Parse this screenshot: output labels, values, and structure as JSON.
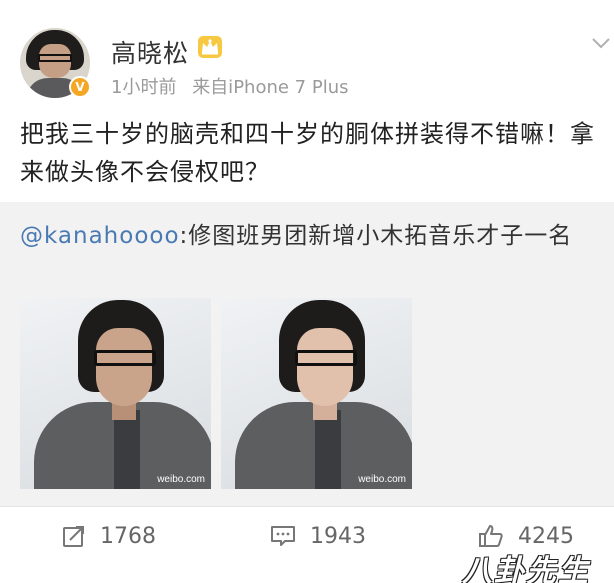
{
  "post": {
    "author": "高晓松",
    "time": "1小时前",
    "source": "来自iPhone 7 Plus",
    "verified_mark": "V",
    "text": "把我三十岁的脑壳和四十岁的胴体拼装得不错嘛！拿来做头像不会侵权吧？",
    "icons": {
      "crown": "crown-badge-icon",
      "menu": "chevron-down-icon",
      "repost": "repost-icon",
      "comment": "comment-icon",
      "like": "thumbs-up-icon"
    }
  },
  "repost": {
    "mention": "@kanahoooo",
    "text": ":修图班男团新增小木拓音乐才子一名",
    "images": [
      {
        "watermark": "weibo.com"
      },
      {
        "watermark": "weibo.com"
      }
    ]
  },
  "actions": {
    "reposts": "1768",
    "comments": "1943",
    "likes": "4245"
  },
  "overlay_watermark": "八卦先生",
  "colors": {
    "link": "#4a7ab3",
    "verified": "#f5a623",
    "meta": "#9a9a9a",
    "repost_bg": "#f2f2f2"
  }
}
